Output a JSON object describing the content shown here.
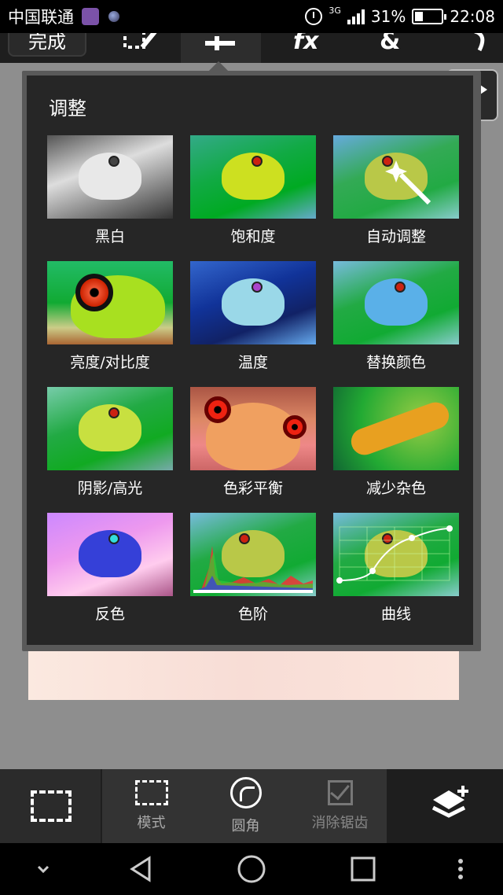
{
  "status_bar": {
    "carrier": "中国联通",
    "network": "3G",
    "battery": "31%",
    "time": "22:08"
  },
  "toolbar": {
    "done_label": "完成"
  },
  "popup": {
    "title": "调整",
    "items": [
      {
        "label": "黑白"
      },
      {
        "label": "饱和度"
      },
      {
        "label": "自动调整"
      },
      {
        "label": "亮度/对比度"
      },
      {
        "label": "温度"
      },
      {
        "label": "替换颜色"
      },
      {
        "label": "阴影/高光"
      },
      {
        "label": "色彩平衡"
      },
      {
        "label": "减少杂色"
      },
      {
        "label": "反色"
      },
      {
        "label": "色阶"
      },
      {
        "label": "曲线"
      }
    ]
  },
  "bottom_bar": {
    "mode_label": "模式",
    "round_label": "圆角",
    "antialias_label": "消除锯齿"
  }
}
